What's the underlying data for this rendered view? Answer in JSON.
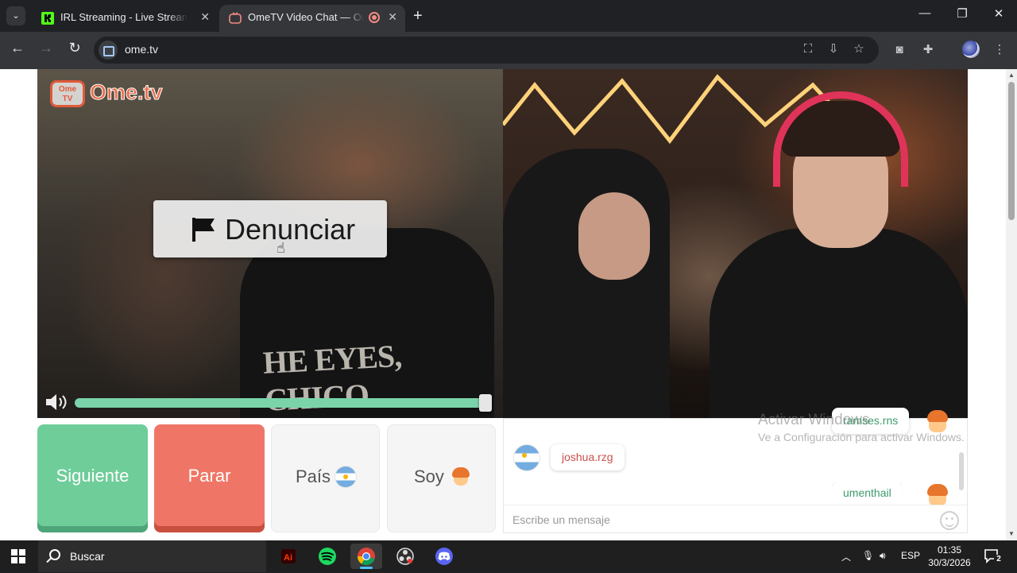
{
  "browser": {
    "tabs": [
      {
        "title": "IRL Streaming - Live Streams on Kick",
        "active": false,
        "favicon": "kick-icon"
      },
      {
        "title": "OmeTV Video Chat — OmeTV",
        "active": true,
        "favicon": "ometv-icon",
        "recording": true
      }
    ],
    "url": "ome.tv"
  },
  "page": {
    "logo": {
      "badge_top": "Ome",
      "badge_bottom": "TV",
      "text": "Ome.tv"
    },
    "report_button": {
      "label": "Denunciar",
      "icon": "flag-icon"
    },
    "volume": {
      "level": 1.0
    },
    "left_video": {
      "shirt_text": "HE EYES, CHICO"
    },
    "controls": {
      "next": "Siguiente",
      "stop": "Parar",
      "country": "País",
      "gender": "Soy"
    },
    "chat": {
      "messages": [
        {
          "user": "ramses.rns",
          "side": "right",
          "avatar": "boy-avatar-icon",
          "color": "#3e9a6d"
        },
        {
          "user": "joshua.rzg",
          "side": "left",
          "avatar": "argentina-flag-icon",
          "color": "#c9504a"
        },
        {
          "user": "umenthail",
          "side": "right",
          "avatar": "boy-avatar-icon",
          "color": "#3e9a6d"
        }
      ],
      "input_placeholder": "Escribe un mensaje"
    },
    "watermark": {
      "title": "Activar Windows",
      "subtitle": "Ve a Configuración para activar Windows."
    }
  },
  "taskbar": {
    "search_placeholder": "Buscar",
    "language": "ESP",
    "time": "01:35",
    "date": "30/3/2026",
    "notification_count": "2"
  }
}
